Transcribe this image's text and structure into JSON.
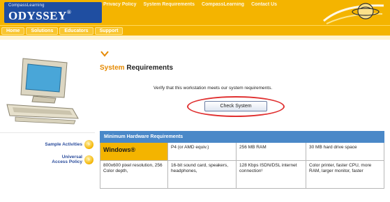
{
  "brand": {
    "small": "CompassLearning",
    "name": "ODYSSEY",
    "trademark": "®"
  },
  "top_links": [
    "Privacy Policy",
    "System Requirements",
    "CompassLearning",
    "Contact Us"
  ],
  "nav": [
    "Home",
    "Solutions",
    "Educators",
    "Support"
  ],
  "page": {
    "title_accent": "System",
    "title_rest": " Requirements",
    "verify_text": "Verify that this workstation meets our system requirements.",
    "check_button": "Check System"
  },
  "sidebar": {
    "sample_activities": "Sample Activities",
    "universal_access": "Universal\nAccess Policy"
  },
  "requirements": {
    "header": "Minimum Hardware Requirements",
    "rows": [
      [
        "Windows®",
        "P4 (or AMD equiv.)",
        "256 MB RAM",
        "30 MB hard drive space"
      ],
      [
        "800x600 pixel resolution, 256 Color depth,",
        "16-bit sound card, speakers, headphones,",
        "128 Kbps ISDN/DSL internet connection¹",
        "Color printer, faster CPU, more RAM, larger monitor, faster"
      ]
    ]
  },
  "colors": {
    "header_gold": "#f4b400",
    "brand_blue": "#1f4ea1",
    "table_blue": "#4a88c8",
    "accent_orange": "#e58900",
    "highlight_red": "#e03030"
  }
}
